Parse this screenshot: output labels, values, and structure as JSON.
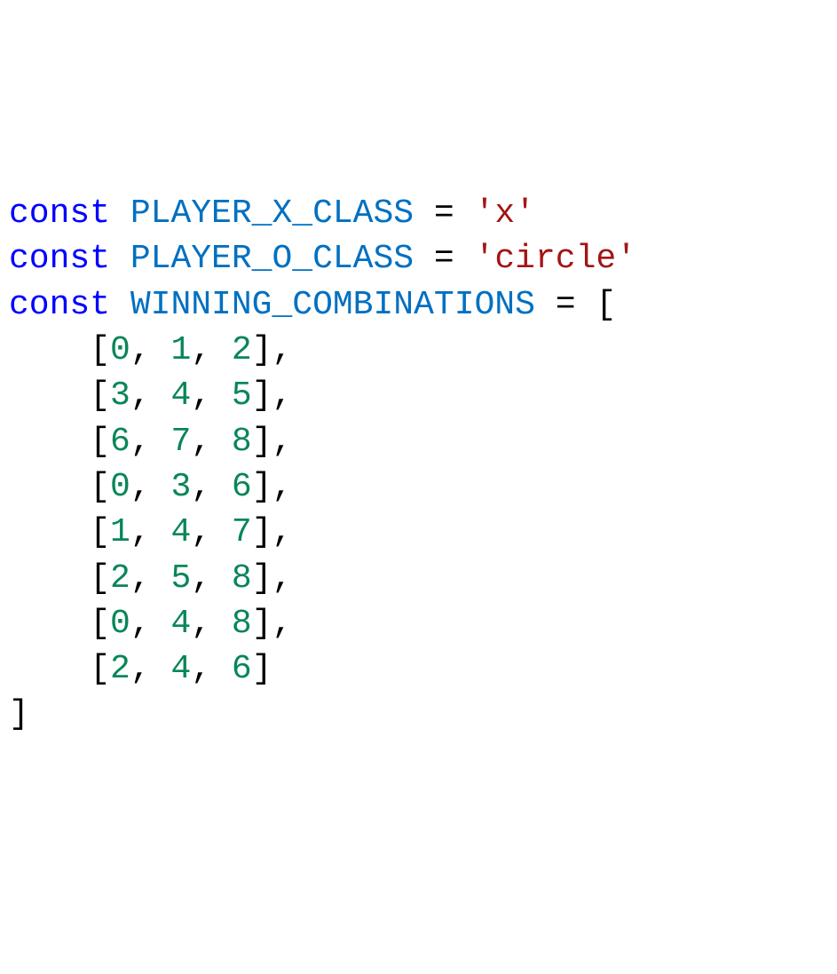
{
  "code": {
    "line1": {
      "keyword": "const",
      "sp1": " ",
      "var": "PLAYER_X_CLASS",
      "sp2": " ",
      "eq": "=",
      "sp3": " ",
      "string": "'x'"
    },
    "line2": {
      "keyword": "const",
      "sp1": " ",
      "var": "PLAYER_O_CLASS",
      "sp2": " ",
      "eq": "=",
      "sp3": " ",
      "string": "'circle'"
    },
    "line3": {
      "keyword": "const",
      "sp1": " ",
      "var": "WINNING_COMBINATIONS",
      "sp2": " ",
      "eq": "=",
      "sp3": " ",
      "bracket": "["
    },
    "arrays": [
      {
        "a": "0",
        "b": "1",
        "c": "2",
        "trailing": ","
      },
      {
        "a": "3",
        "b": "4",
        "c": "5",
        "trailing": ","
      },
      {
        "a": "6",
        "b": "7",
        "c": "8",
        "trailing": ","
      },
      {
        "a": "0",
        "b": "3",
        "c": "6",
        "trailing": ","
      },
      {
        "a": "1",
        "b": "4",
        "c": "7",
        "trailing": ","
      },
      {
        "a": "2",
        "b": "5",
        "c": "8",
        "trailing": ","
      },
      {
        "a": "0",
        "b": "4",
        "c": "8",
        "trailing": ","
      },
      {
        "a": "2",
        "b": "4",
        "c": "6",
        "trailing": ""
      }
    ],
    "lineEnd": {
      "bracket": "]"
    },
    "indent": "    ",
    "openB": "[",
    "closeB": "]",
    "comma": ", "
  }
}
